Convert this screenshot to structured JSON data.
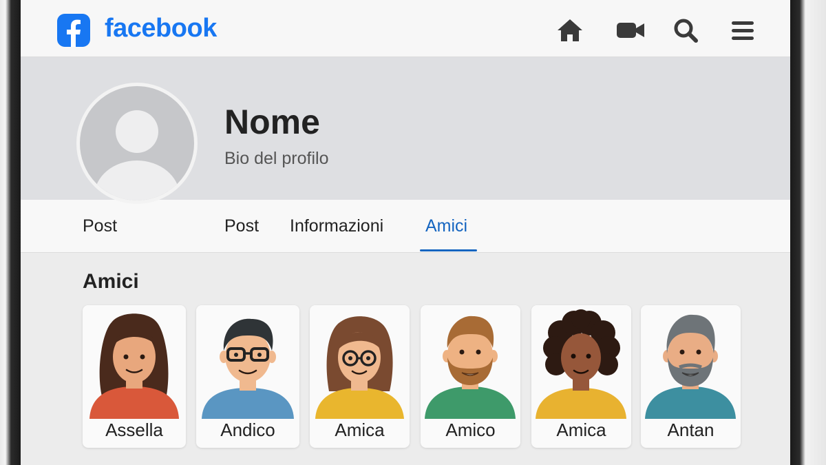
{
  "app": {
    "brand": "facebook",
    "brand_color": "#1877f2",
    "accent_color": "#1565c0"
  },
  "topbar": {
    "logo_icon": "facebook-f-icon",
    "nav_icons": [
      "home-icon",
      "video-icon",
      "search-icon",
      "menu-icon"
    ]
  },
  "profile": {
    "name": "Nome",
    "bio": "Bio del profilo",
    "avatar_icon": "default-avatar-icon"
  },
  "tabs": {
    "items": [
      {
        "label": "Post",
        "active": false
      },
      {
        "label": "Post",
        "active": false
      },
      {
        "label": "Informazioni",
        "active": false
      },
      {
        "label": "Amici",
        "active": true
      }
    ]
  },
  "friends": {
    "title": "Amici",
    "items": [
      {
        "name": "Assella",
        "shirt": "#d9583a",
        "hair": "#4a2a1c",
        "skin": "#e8a77d"
      },
      {
        "name": "Andico",
        "shirt": "#5a96c2",
        "hair": "#2f3437",
        "skin": "#f0b98f"
      },
      {
        "name": "Amica",
        "shirt": "#e9b62e",
        "hair": "#7a4a30",
        "skin": "#f0b98f"
      },
      {
        "name": "Amico",
        "shirt": "#3e9a6a",
        "hair": "#a86b35",
        "skin": "#eeb283"
      },
      {
        "name": "Amica",
        "shirt": "#e8b230",
        "hair": "#2d1a12",
        "skin": "#96573a"
      },
      {
        "name": "Antan",
        "shirt": "#3d8fa0",
        "hair": "#6e7478",
        "skin": "#e9ad85"
      }
    ]
  }
}
